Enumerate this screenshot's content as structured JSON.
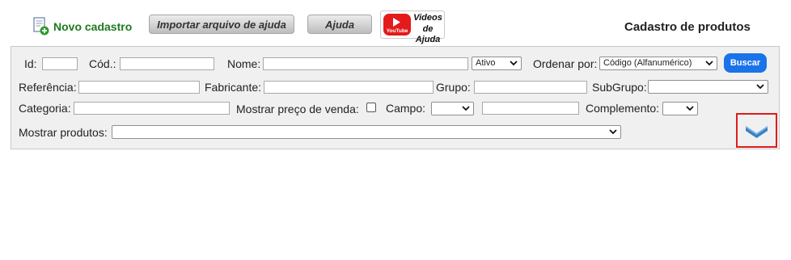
{
  "toolbar": {
    "new_label": "Novo cadastro",
    "import_label": "Importar arquivo de ajuda",
    "help_label": "Ajuda",
    "videos_line1": "Videos",
    "videos_line2": "de Ajuda",
    "youtube_text": "YouTube"
  },
  "page_title": "Cadastro de produtos",
  "filters": {
    "id_label": "Id:",
    "id_value": "",
    "cod_label": "Cód.:",
    "cod_value": "",
    "nome_label": "Nome:",
    "nome_value": "",
    "status_value": "Ativo",
    "ordenar_label": "Ordenar por:",
    "ordenar_value": "Código (Alfanumérico)",
    "buscar_label": "Buscar",
    "referencia_label": "Referência:",
    "fabricante_label": "Fabricante:",
    "grupo_label": "Grupo:",
    "subgrupo_label": "SubGrupo:",
    "subgrupo_value": "",
    "categoria_label": "Categoria:",
    "mostrar_preco_label": "Mostrar preço de venda:",
    "mostrar_preco_checked": false,
    "campo_label": "Campo:",
    "campo_value": "",
    "complemento_label": "Complemento:",
    "complemento_value": "",
    "mostrar_produtos_label": "Mostrar produtos:",
    "mostrar_produtos_value": ""
  },
  "colors": {
    "accent": "#1a73e8",
    "new_green": "#1e7a1e",
    "highlight": "#e01b1b",
    "panel_bg": "#f0f0f0",
    "expand_icon": "#3b7fc4"
  },
  "icons": [
    "document-add-icon",
    "youtube-icon",
    "chevron-down-icon",
    "expand-chevron-icon"
  ]
}
